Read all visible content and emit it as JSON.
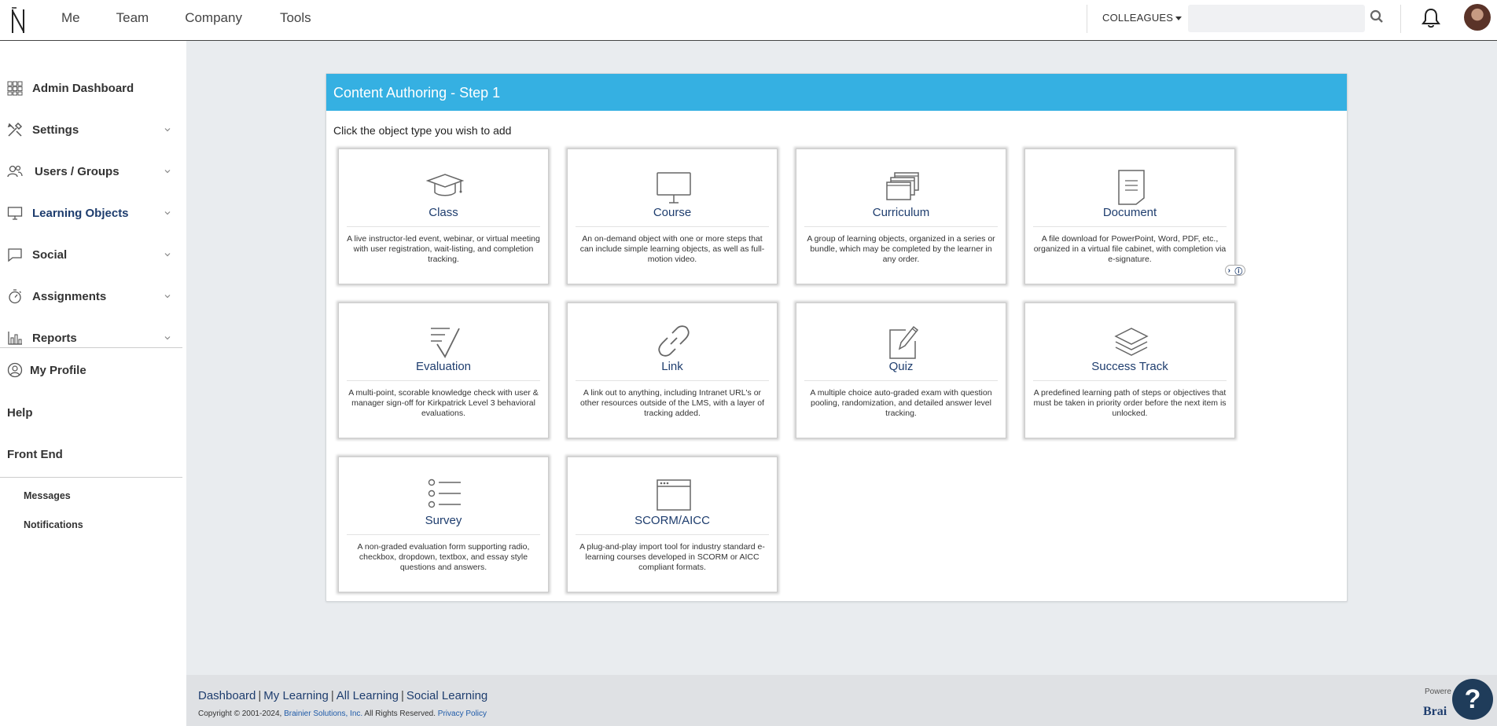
{
  "topnav": {
    "items": [
      "Me",
      "Team",
      "Company",
      "Tools"
    ],
    "colleagues_label": "COLLEAGUES",
    "search_placeholder": ""
  },
  "sidebar": {
    "items": [
      {
        "label": "Admin Dashboard",
        "icon": "grid-icon",
        "chevron": false
      },
      {
        "label": "Settings",
        "icon": "tools-icon",
        "chevron": true
      },
      {
        "label": "Users / Groups",
        "icon": "users-icon",
        "chevron": true
      },
      {
        "label": "Learning Objects",
        "icon": "monitor-icon",
        "chevron": true
      },
      {
        "label": "Social",
        "icon": "chat-icon",
        "chevron": true
      },
      {
        "label": "Assignments",
        "icon": "stopwatch-icon",
        "chevron": true
      },
      {
        "label": "Reports",
        "icon": "bar-chart-icon",
        "chevron": true
      }
    ],
    "my_profile": "My Profile",
    "help": "Help",
    "front_end": "Front End",
    "messages": "Messages",
    "notifications": "Notifications"
  },
  "card": {
    "title": "Content Authoring - Step 1",
    "instruction": "Click the object type you wish to add",
    "tiles": [
      {
        "title": "Class",
        "icon": "graduation-cap-icon",
        "desc": "A live instructor-led event, webinar, or virtual meeting with user registration, wait-listing, and completion tracking."
      },
      {
        "title": "Course",
        "icon": "monitor-icon",
        "desc": "An on-demand object with one or more steps that can include simple learning objects, as well as full-motion video."
      },
      {
        "title": "Curriculum",
        "icon": "stacked-windows-icon",
        "desc": "A group of learning objects, organized in a series or bundle, which may be completed by the learner in any order."
      },
      {
        "title": "Document",
        "icon": "document-icon",
        "desc": "A file download for PowerPoint, Word, PDF, etc., organized in a virtual file cabinet, with completion via e-signature."
      },
      {
        "title": "Evaluation",
        "icon": "checklist-icon",
        "desc": "A multi-point, scorable knowledge check with user & manager sign-off for Kirkpatrick Level 3 behavioral evaluations."
      },
      {
        "title": "Link",
        "icon": "link-icon",
        "desc": "A link out to anything, including Intranet URL's or other resources outside of the LMS, with a layer of tracking added."
      },
      {
        "title": "Quiz",
        "icon": "pencil-paper-icon",
        "desc": "A multiple choice auto-graded exam with question pooling, randomization, and detailed answer level tracking."
      },
      {
        "title": "Success Track",
        "icon": "layers-icon",
        "desc": "A predefined learning path of steps or objectives that must be taken in priority order before the next item is unlocked."
      },
      {
        "title": "Survey",
        "icon": "list-icon",
        "desc": "A non-graded evaluation form supporting radio, checkbox, dropdown, textbox, and essay style questions and answers."
      },
      {
        "title": "SCORM/AICC",
        "icon": "browser-window-icon",
        "desc": "A plug-and-play import tool for industry standard e-learning courses developed in SCORM or AICC compliant formats."
      }
    ]
  },
  "footer": {
    "links": [
      "Dashboard",
      "My Learning",
      "All Learning",
      "Social Learning"
    ],
    "copyright": "Copyright © 2001-2024,",
    "company": "Brainier Solutions, Inc.",
    "rights": "All Rights Reserved.",
    "privacy": "Privacy Policy",
    "powered": "Powere",
    "brand": "Brai",
    "help_fab": "?"
  },
  "colors": {
    "header_blue": "#35b0e2",
    "highlight": "#8a2f5b",
    "link_navy": "#1e3d6e"
  }
}
